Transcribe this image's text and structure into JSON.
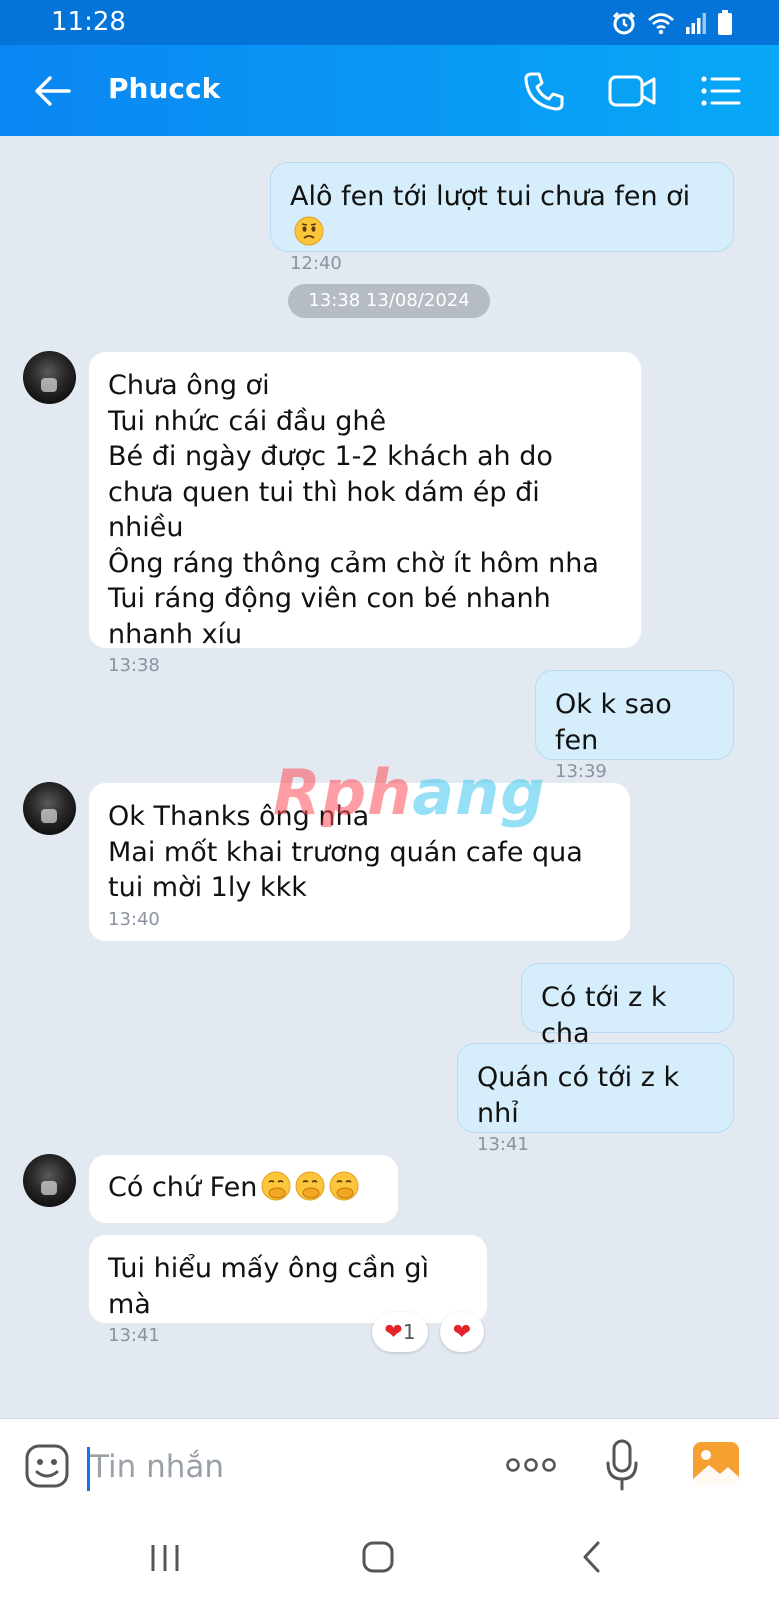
{
  "status_bar": {
    "time": "11:28"
  },
  "header": {
    "contact_name": "Phucck",
    "icons": [
      "back-arrow-icon",
      "phone-icon",
      "video-camera-icon",
      "menu-list-icon"
    ]
  },
  "messages": [
    {
      "direction": "out",
      "text": "Alô fen tới lượt tui chưa fen ơi",
      "emoji": "worried-face",
      "time": "12:40"
    },
    {
      "direction": "in",
      "text": "Chưa ông ơi\nTui nhức cái đầu ghê\nBé đi ngày được 1-2 khách ah do chưa quen tui thì hok dám ép đi nhiều\nÔng ráng thông cảm chờ ít hôm nha\nTui ráng động viên con bé nhanh nhanh xíu",
      "time": "13:38"
    },
    {
      "direction": "out",
      "text": "Ok k sao fen",
      "time": "13:39"
    },
    {
      "direction": "in",
      "text": "Ok Thanks ông nha\nMai mốt khai trương quán cafe qua tui mời 1ly kkk",
      "time": "13:40"
    },
    {
      "direction": "out",
      "text": "Có tới z k cha"
    },
    {
      "direction": "out",
      "text": "Quán có tới z k nhỉ",
      "time": "13:41"
    },
    {
      "direction": "in",
      "text": "Có chứ Fen",
      "emoji": "hand-over-mouth-face x3"
    },
    {
      "direction": "in",
      "text": "Tui hiểu mấy ông cần gì mà",
      "time": "13:41"
    }
  ],
  "date_separator": "13:38 13/08/2024",
  "reactions": {
    "heart_count": "1"
  },
  "watermark": {
    "part1": "Rph",
    "part2": "ang"
  },
  "input": {
    "placeholder": "Tin nhắn"
  },
  "colors": {
    "header": "#0a86f2",
    "outgoing_bubble": "#d6eefb",
    "incoming_bubble": "#ffffff",
    "background": "#e2e9f1"
  }
}
